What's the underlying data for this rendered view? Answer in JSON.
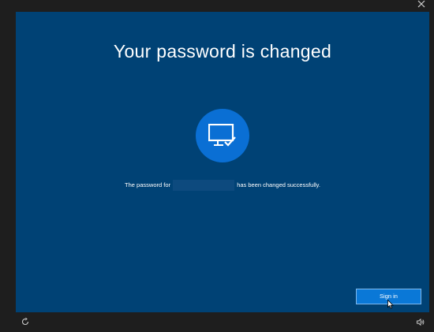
{
  "window": {
    "close_glyph": "×"
  },
  "dialog": {
    "title": "Your password is changed",
    "icon": "monitor-check-icon",
    "message_prefix": "The password for",
    "message_suffix": "has been changed successfully.",
    "signin_label": "Sign in"
  },
  "footer": {
    "left_icon": "ease-of-access-icon",
    "right_icon": "volume-icon"
  },
  "colors": {
    "background": "#1e1e1e",
    "dialog": "#004275",
    "accent": "#0a78d7"
  }
}
